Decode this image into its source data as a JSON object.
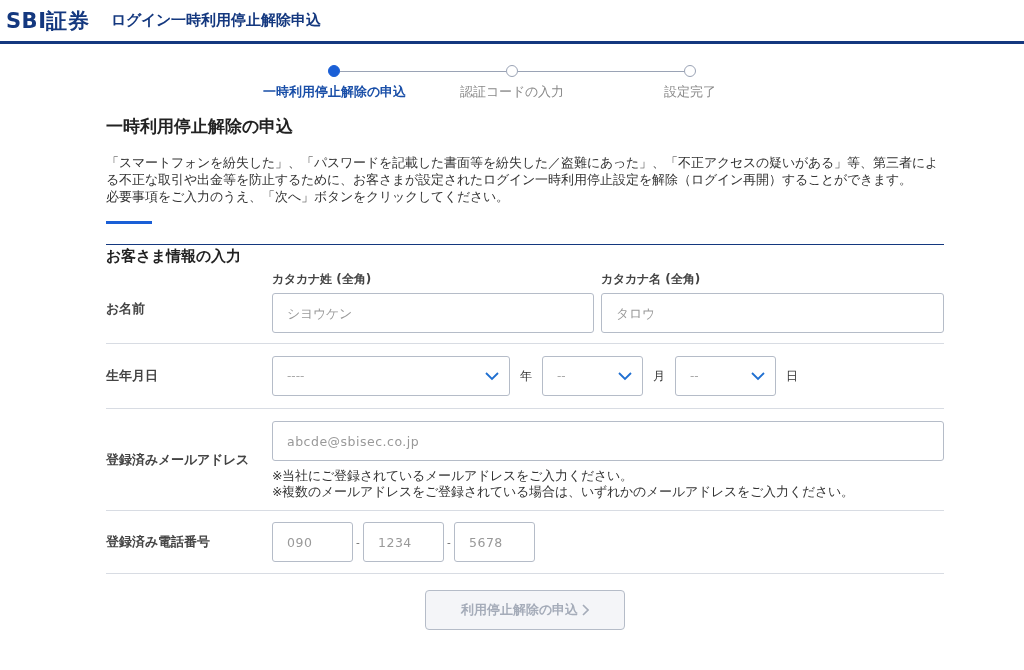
{
  "header": {
    "logo": "SBI証券",
    "title": "ログイン一時利用停止解除申込"
  },
  "steps": [
    {
      "label": "一時利用停止解除の申込",
      "selected": true
    },
    {
      "label": "認証コードの入力",
      "selected": false
    },
    {
      "label": "設定完了",
      "selected": false
    }
  ],
  "page_title": "一時利用停止解除の申込",
  "intro": [
    "「スマートフォンを紛失した」、「パスワードを記載した書面等を紛失した／盗難にあった」、「不正アクセスの疑いがある」等、第三者による不正な取引や出金等を防止するために、お客さまが設定されたログイン一時利用停止設定を解除（ログイン再開）することができます。",
    "必要事項をご入力のうえ、「次へ」ボタンをクリックしてください。"
  ],
  "section_title": "お客さま情報の入力",
  "rows": [
    {
      "kind": "name",
      "label": "お名前",
      "fields": [
        {
          "label": "カタカナ姓 (全角)",
          "placeholder": "シヨウケン"
        },
        {
          "label": "カタカナ名 (全角)",
          "placeholder": "タロウ"
        }
      ]
    },
    {
      "kind": "date",
      "label": "生年月日",
      "selects": [
        {
          "placeholder": "----",
          "unit": "年"
        },
        {
          "placeholder": "--",
          "unit": "月"
        },
        {
          "placeholder": "--",
          "unit": "日"
        }
      ]
    },
    {
      "kind": "email",
      "label": "登録済みメールアドレス",
      "placeholder": "abcde@sbisec.co.jp",
      "notes": [
        "※当社にご登録されているメールアドレスをご入力ください。",
        "※複数のメールアドレスをご登録されている場合は、いずれかのメールアドレスをご入力ください。"
      ]
    },
    {
      "kind": "phone",
      "label": "登録済み電話番号",
      "parts": [
        {
          "placeholder": "090"
        },
        {
          "placeholder": "1234"
        },
        {
          "placeholder": "5678"
        }
      ],
      "separator": "-"
    }
  ],
  "submit": {
    "label": "利用停止解除の申込",
    "disabled": true
  }
}
